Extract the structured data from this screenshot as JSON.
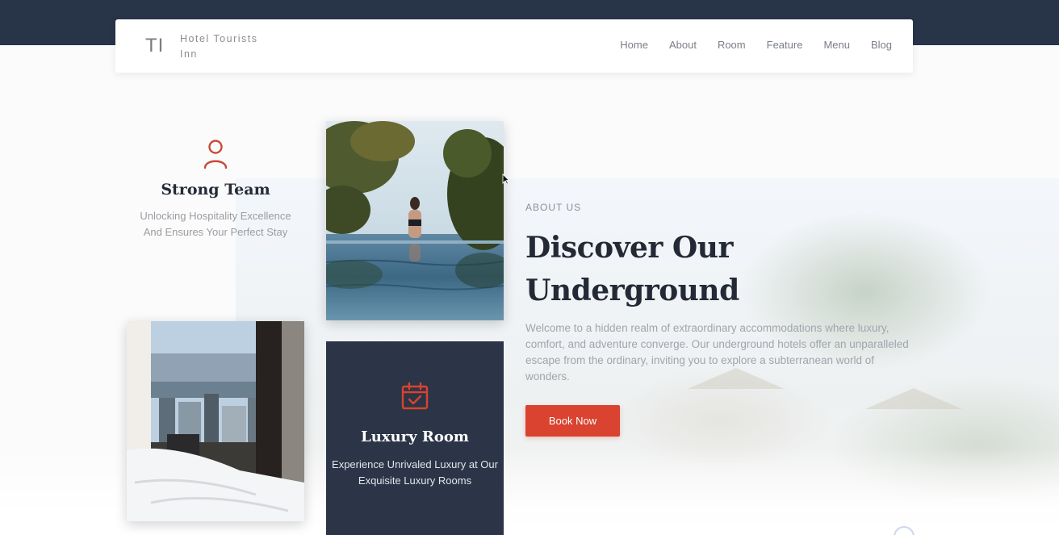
{
  "brand": {
    "mark": "TI",
    "name": "Hotel Tourists Inn"
  },
  "nav": {
    "items": [
      {
        "label": "Home"
      },
      {
        "label": "About"
      },
      {
        "label": "Room"
      },
      {
        "label": "Feature"
      },
      {
        "label": "Menu"
      },
      {
        "label": "Blog"
      }
    ]
  },
  "team_card": {
    "icon": "user-icon",
    "title": "Strong Team",
    "text": "Unlocking Hospitality Excellence And Ensures Your Perfect Stay"
  },
  "luxury_card": {
    "icon": "calendar-check-icon",
    "title": "Luxury Room",
    "text": "Experience Unrivaled Luxury at Our Exquisite Luxury Rooms"
  },
  "about": {
    "eyebrow": "ABOUT US",
    "heading": "Discover Our Underground",
    "text": "Welcome to a hidden realm of extraordinary accommodations where luxury, comfort, and adventure converge. Our underground hotels offer an unparalleled escape from the ordinary, inviting you to explore a subterranean world of wonders.",
    "cta_label": "Book Now"
  },
  "colors": {
    "header_band": "#283549",
    "card_dark": "#2b3547",
    "accent": "#d9432f",
    "heading": "#232a36"
  }
}
